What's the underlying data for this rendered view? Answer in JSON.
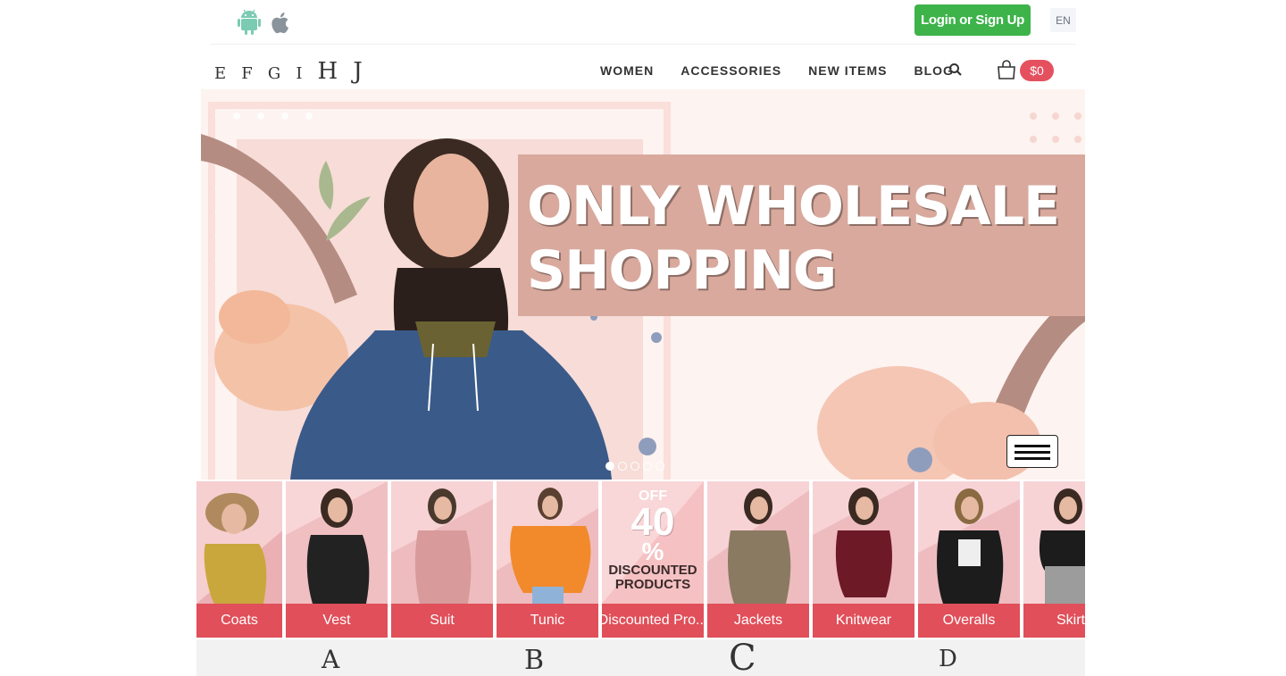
{
  "topbar": {
    "android_icon": "android-icon",
    "apple_icon": "apple-icon",
    "login_label": "Login or Sign Up",
    "language": "EN"
  },
  "logo": {
    "letters": [
      "E",
      "F",
      "G",
      "I",
      "H",
      "J"
    ]
  },
  "nav": {
    "items": [
      "WOMEN",
      "ACCESSORIES",
      "NEW ITEMS",
      "BLOG"
    ],
    "search_icon": "search-icon",
    "cart_icon": "shopping-bag-icon",
    "cart_total": "$0"
  },
  "hero": {
    "title_line1": "ONLY WHOLESALE",
    "title_line2": "SHOPPING",
    "slides_count": 5,
    "active_slide": 1,
    "menu_icon": "hamburger-icon"
  },
  "categories": [
    {
      "label": "Coats"
    },
    {
      "label": "Vest"
    },
    {
      "label": "Suit"
    },
    {
      "label": "Tunic"
    },
    {
      "label": "Discounted Pro..."
    },
    {
      "label": "Jackets"
    },
    {
      "label": "Knitwear"
    },
    {
      "label": "Overalls"
    },
    {
      "label": "Skirt"
    }
  ],
  "promo_badge": {
    "off": "OFF",
    "percent": "40",
    "symbol": "%",
    "line1": "DISCOUNTED",
    "line2": "PRODUCTS"
  },
  "bottom_letters": [
    "A",
    "B",
    "C",
    "D"
  ],
  "colors": {
    "accent_red": "#e04f5a",
    "login_green": "#3db34a",
    "hero_pink": "#d9a99d"
  }
}
